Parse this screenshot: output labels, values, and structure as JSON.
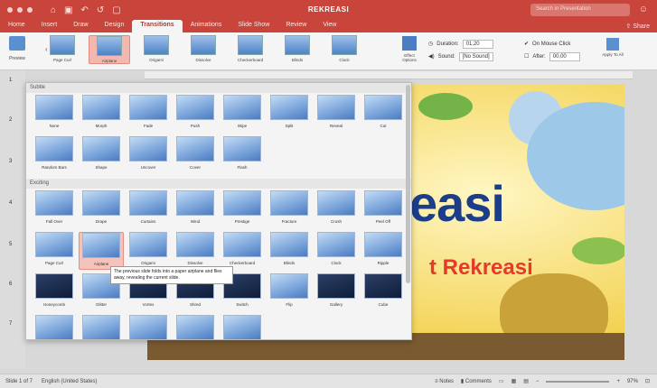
{
  "titlebar": {
    "doc_title": "REKREASI",
    "search_placeholder": "Search in Presentation",
    "quick_access": [
      "⌂",
      "▣",
      "↶",
      "↺",
      "▢"
    ]
  },
  "tabs": [
    {
      "label": "Home"
    },
    {
      "label": "Insert"
    },
    {
      "label": "Draw"
    },
    {
      "label": "Design"
    },
    {
      "label": "Transitions",
      "active": true
    },
    {
      "label": "Animations"
    },
    {
      "label": "Slide Show"
    },
    {
      "label": "Review"
    },
    {
      "label": "View"
    }
  ],
  "share_label": "Share",
  "ribbon": {
    "preview_label": "Preview",
    "gallery": [
      {
        "label": "Page Curl"
      },
      {
        "label": "Airplane",
        "selected": true
      },
      {
        "label": "Origami"
      },
      {
        "label": "Dissolve"
      },
      {
        "label": "Checkerboard"
      },
      {
        "label": "Blinds"
      },
      {
        "label": "Clock"
      }
    ],
    "effect_options_label": "Effect Options",
    "duration_label": "Duration:",
    "duration_value": "01,20",
    "sound_label": "Sound:",
    "sound_value": "[No Sound]",
    "on_mouse_click_label": "On Mouse Click",
    "after_label": "After:",
    "after_value": "00,00",
    "apply_label": "Apply To All"
  },
  "rail_numbers": [
    "1",
    "2",
    "3",
    "4",
    "5",
    "6",
    "7"
  ],
  "gallery": {
    "subtle_label": "Subtle",
    "exciting_label": "Exciting",
    "subtle": [
      "None",
      "Morph",
      "Fade",
      "Push",
      "Wipe",
      "Split",
      "Reveal",
      "Cut",
      "Random Bars",
      "Shape",
      "Uncover",
      "Cover",
      "Flash"
    ],
    "exciting": [
      "Fall Over",
      "Drape",
      "Curtains",
      "Wind",
      "Prestige",
      "Fracture",
      "Crush",
      "Peel Off",
      "Page Curl",
      "Airplane",
      "Origami",
      "Dissolve",
      "Checkerboard",
      "Blinds",
      "Clock",
      "Ripple",
      "Honeycomb",
      "Glitter",
      "Vortex",
      "Shred",
      "Switch",
      "Flip",
      "Gallery",
      "Cube",
      "",
      "",
      "",
      "",
      ""
    ],
    "tooltip": "The previous slide folds into a paper airplane and flies away, revealing the current slide."
  },
  "slide": {
    "title_part": "easi",
    "subtitle_part": "t Rekreasi"
  },
  "status": {
    "slide_info": "Slide 1 of 7",
    "language": "English (United States)",
    "notes": "Notes",
    "comments": "Comments",
    "zoom": "97%"
  }
}
